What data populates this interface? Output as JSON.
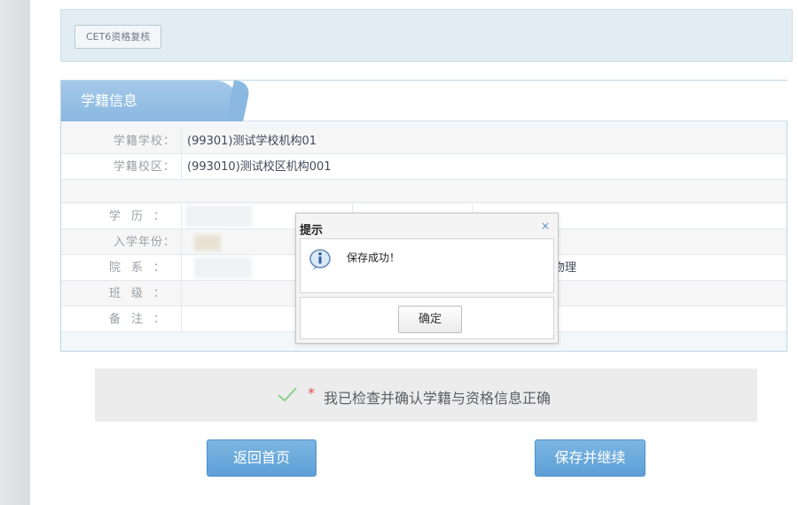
{
  "tab": {
    "label": "CET6资格复核"
  },
  "panel": {
    "title": "学籍信息",
    "rows": [
      {
        "label": "学籍学校：",
        "value": "(99301)测试学校机构01"
      },
      {
        "label": "学籍校区：",
        "value": "(993010)测试校区机构001"
      },
      {
        "label": "学历："
      },
      {
        "label": "入学年份："
      },
      {
        "label": "院系：",
        "partial_value": "物理"
      },
      {
        "label": "班级："
      },
      {
        "label": "备注："
      }
    ]
  },
  "confirm": {
    "required_mark": "*",
    "text": "我已检查并确认学籍与资格信息正确"
  },
  "buttons": {
    "home": "返回首页",
    "save_continue": "保存并继续"
  },
  "dialog": {
    "title": "提示",
    "close": "×",
    "message": "保存成功！",
    "ok": "确定"
  },
  "colors": {
    "accent": "#6aa8dc",
    "panel_header": "#96c0e5",
    "check": "#8bd18b",
    "required": "#e05050"
  }
}
